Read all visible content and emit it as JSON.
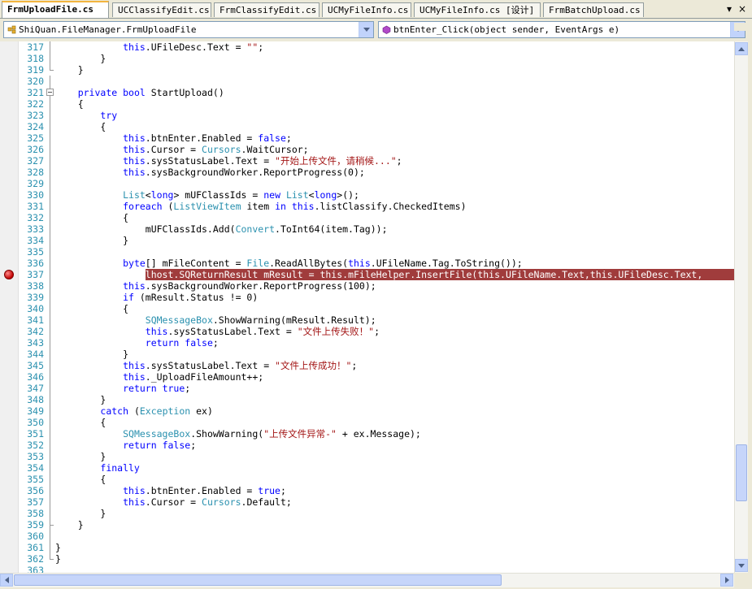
{
  "tabs": [
    {
      "label": "FrmUploadFile.cs",
      "active": true
    },
    {
      "label": "UCClassifyEdit.cs",
      "active": false
    },
    {
      "label": "FrmClassifyEdit.cs",
      "active": false
    },
    {
      "label": "UCMyFileInfo.cs",
      "active": false
    },
    {
      "label": "UCMyFileInfo.cs [设计]",
      "active": false
    },
    {
      "label": "FrmBatchUpload.cs",
      "active": false
    }
  ],
  "tab_controls": {
    "dropdown_icon": "chevron-down-icon",
    "close_icon": "close-icon",
    "close_glyph": "×",
    "dropdown_glyph": "▾"
  },
  "navigation": {
    "class_combo": {
      "value": "ShiQuan.FileManager.FrmUploadFile",
      "icon": "class-icon"
    },
    "member_combo": {
      "value": "btnEnter_Click(object sender, EventArgs e)",
      "icon": "method-icon"
    }
  },
  "colors": {
    "keyword": "#0000ff",
    "type": "#2b91af",
    "string": "#a31515",
    "line_number": "#2b91af",
    "breakpoint_highlight": "#a03c3c"
  },
  "breakpoint_line": 337,
  "lines": [
    {
      "n": "317",
      "html": "            <span class='k'>this</span>.UFileDesc.Text = <span class='s'>\"\"</span>;"
    },
    {
      "n": "318",
      "html": "        }"
    },
    {
      "n": "319",
      "html": "    }"
    },
    {
      "n": "320",
      "html": ""
    },
    {
      "n": "321",
      "html": "    <span class='k'>private</span> <span class='k'>bool</span> StartUpload()"
    },
    {
      "n": "322",
      "html": "    {"
    },
    {
      "n": "323",
      "html": "        <span class='k'>try</span>"
    },
    {
      "n": "324",
      "html": "        {"
    },
    {
      "n": "325",
      "html": "            <span class='k'>this</span>.btnEnter.Enabled = <span class='k'>false</span>;"
    },
    {
      "n": "326",
      "html": "            <span class='k'>this</span>.Cursor = <span class='t'>Cursors</span>.WaitCursor;"
    },
    {
      "n": "327",
      "html": "            <span class='k'>this</span>.sysStatusLabel.Text = <span class='s'>\"开始上传文件，请稍候...\"</span>;"
    },
    {
      "n": "328",
      "html": "            <span class='k'>this</span>.sysBackgroundWorker.ReportProgress(0);"
    },
    {
      "n": "329",
      "html": ""
    },
    {
      "n": "330",
      "html": "            <span class='t'>List</span>&lt;<span class='k'>long</span>&gt; mUFClassIds = <span class='k'>new</span> <span class='t'>List</span>&lt;<span class='k'>long</span>&gt;();"
    },
    {
      "n": "331",
      "html": "            <span class='k'>foreach</span> (<span class='t'>ListViewItem</span> item <span class='k'>in</span> <span class='k'>this</span>.listClassify.CheckedItems)"
    },
    {
      "n": "332",
      "html": "            {"
    },
    {
      "n": "333",
      "html": "                mUFClassIds.Add(<span class='t'>Convert</span>.ToInt64(item.Tag));"
    },
    {
      "n": "334",
      "html": "            }"
    },
    {
      "n": "335",
      "html": ""
    },
    {
      "n": "336",
      "html": "            <span class='k'>byte</span>[] mFileContent = <span class='t'>File</span>.ReadAllBytes(<span class='k'>this</span>.UFileName.Tag.ToString());"
    },
    {
      "n": "337",
      "html": "            localhost.<span class='t'>SQReturnResult</span> mResult = <span class='k'>this</span>.mFileHelper.InsertFile(<span class='k'>this</span>.UFileName.Text,<span class='k'>this</span>.UFileDesc.Text,"
    },
    {
      "n": "338",
      "html": "            <span class='k'>this</span>.sysBackgroundWorker.ReportProgress(100);"
    },
    {
      "n": "339",
      "html": "            <span class='k'>if</span> (mResult.Status != 0)"
    },
    {
      "n": "340",
      "html": "            {"
    },
    {
      "n": "341",
      "html": "                <span class='t'>SQMessageBox</span>.ShowWarning(mResult.Result);"
    },
    {
      "n": "342",
      "html": "                <span class='k'>this</span>.sysStatusLabel.Text = <span class='s'>\"文件上传失败！\"</span>;"
    },
    {
      "n": "343",
      "html": "                <span class='k'>return</span> <span class='k'>false</span>;"
    },
    {
      "n": "344",
      "html": "            }"
    },
    {
      "n": "345",
      "html": "            <span class='k'>this</span>.sysStatusLabel.Text = <span class='s'>\"文件上传成功！\"</span>;"
    },
    {
      "n": "346",
      "html": "            <span class='k'>this</span>._UploadFileAmount++;"
    },
    {
      "n": "347",
      "html": "            <span class='k'>return</span> <span class='k'>true</span>;"
    },
    {
      "n": "348",
      "html": "        }"
    },
    {
      "n": "349",
      "html": "        <span class='k'>catch</span> (<span class='t'>Exception</span> ex)"
    },
    {
      "n": "350",
      "html": "        {"
    },
    {
      "n": "351",
      "html": "            <span class='t'>SQMessageBox</span>.ShowWarning(<span class='s'>\"上传文件异常-\"</span> + ex.Message);"
    },
    {
      "n": "352",
      "html": "            <span class='k'>return</span> <span class='k'>false</span>;"
    },
    {
      "n": "353",
      "html": "        }"
    },
    {
      "n": "354",
      "html": "        <span class='k'>finally</span>"
    },
    {
      "n": "355",
      "html": "        {"
    },
    {
      "n": "356",
      "html": "            <span class='k'>this</span>.btnEnter.Enabled = <span class='k'>true</span>;"
    },
    {
      "n": "357",
      "html": "            <span class='k'>this</span>.Cursor = <span class='t'>Cursors</span>.Default;"
    },
    {
      "n": "358",
      "html": "        }"
    },
    {
      "n": "359",
      "html": "    }"
    },
    {
      "n": "360",
      "html": ""
    },
    {
      "n": "361",
      "html": "}"
    },
    {
      "n": "362",
      "html": "}"
    },
    {
      "n": "363",
      "html": ""
    }
  ]
}
